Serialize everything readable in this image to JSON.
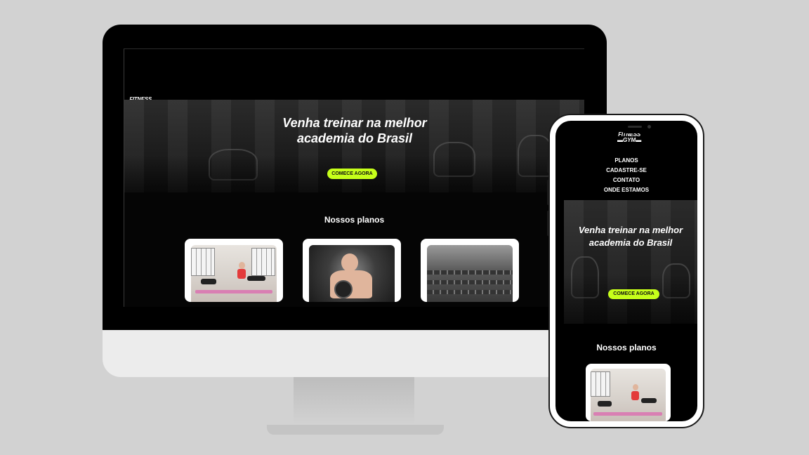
{
  "site": {
    "logo": {
      "line1": "FITNESS",
      "line2": "▬GYM▬"
    },
    "nav": [
      "PLANOS",
      "CADASTRE-SE",
      "CONTATO",
      "ONDE ESTAMOS"
    ],
    "hero": {
      "title_line1": "Venha treinar na melhor",
      "title_line2": "academia do Brasil",
      "cta": "COMECE AGORA"
    },
    "plans": {
      "title": "Nossos planos"
    }
  },
  "colors": {
    "accent": "#c6ff1a",
    "background": "#000000",
    "page_background": "#d2d2d2"
  },
  "icons": {
    "logo": "dumbbell-logo-icon",
    "camera": "camera-icon"
  }
}
